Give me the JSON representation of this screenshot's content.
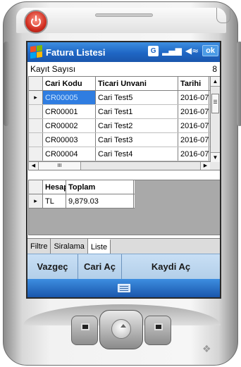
{
  "titlebar": {
    "title": "Fatura Listesi",
    "g_label": "G",
    "signal_icon": "signal-icon",
    "volume_icon": "speaker-icon",
    "ok_label": "ok"
  },
  "record_count": {
    "label": "Kayıt Sayısı",
    "value": "8"
  },
  "cari_grid": {
    "columns": [
      "Cari Kodu",
      "Ticari Unvani",
      "Tarihi"
    ],
    "rows": [
      [
        "CR00005",
        "Cari Test5",
        "2016-07"
      ],
      [
        "CR00001",
        "Cari Test1",
        "2016-07"
      ],
      [
        "CR00002",
        "Cari Test2",
        "2016-07"
      ],
      [
        "CR00003",
        "Cari Test3",
        "2016-07"
      ],
      [
        "CR00004",
        "Cari Test4",
        "2016-07"
      ]
    ],
    "selected_row": 0,
    "row_indicator": "▸",
    "hscroll_thumb": "III"
  },
  "total_grid": {
    "columns": [
      "Hesap",
      "Toplam"
    ],
    "rows": [
      [
        "TL",
        "9,879.03"
      ]
    ],
    "row_indicator": "▸"
  },
  "tabs": [
    "Filtre",
    "Siralama",
    "Liste"
  ],
  "active_tab": "Liste",
  "menubar": {
    "cancel": "Vazgeç",
    "open_account": "Cari Aç",
    "open_record": "Kaydi Aç"
  },
  "colors": {
    "titlebar": "#1f66c4",
    "selection": "#2f7de1",
    "menubar": "#b3cfe9"
  }
}
